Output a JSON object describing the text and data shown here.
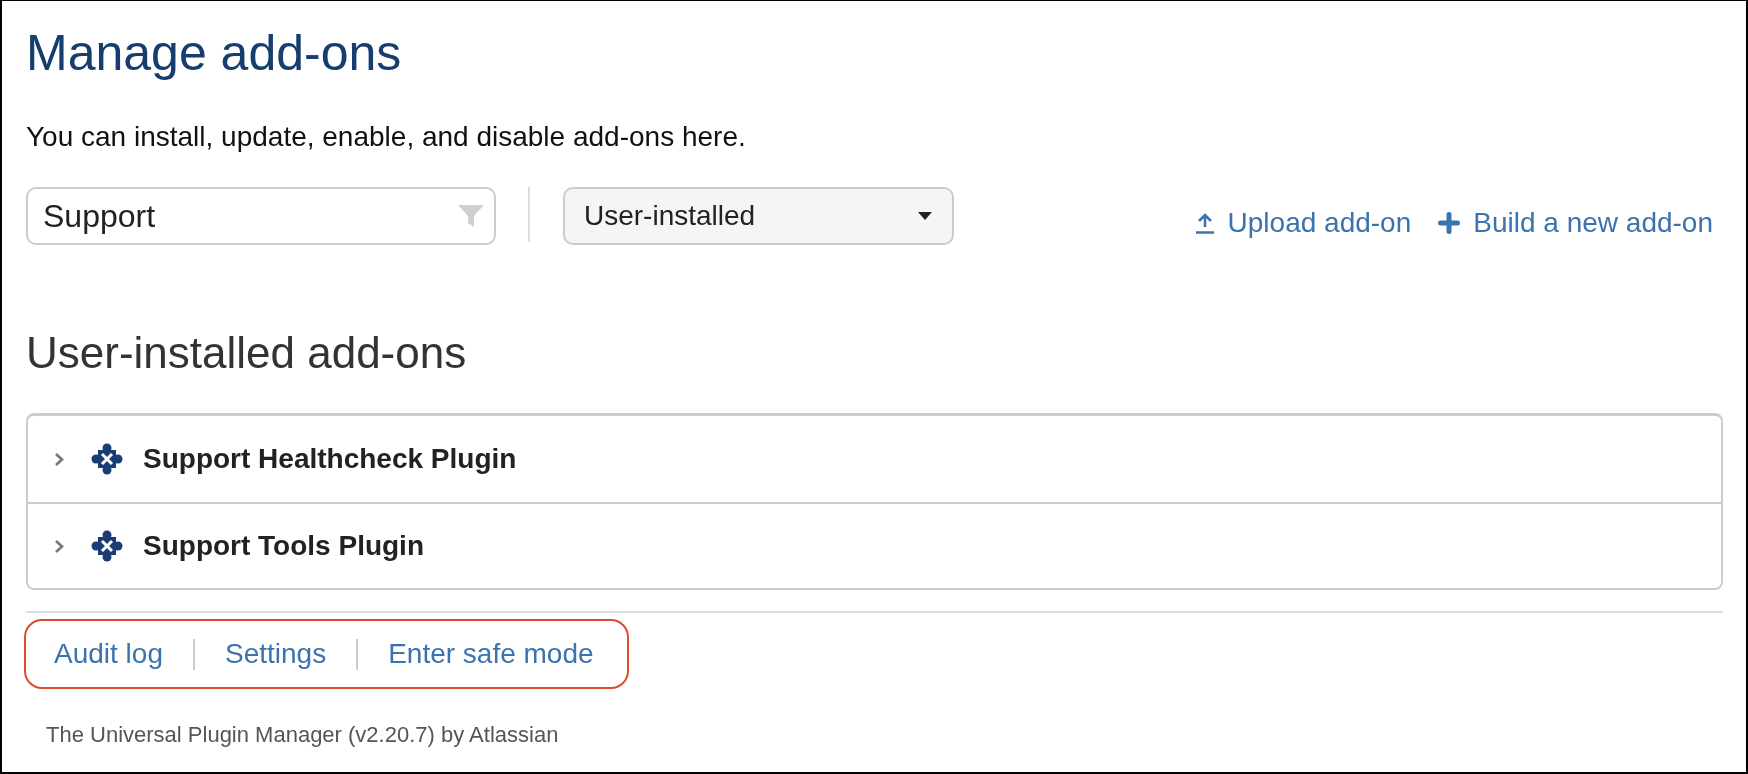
{
  "title": "Manage add-ons",
  "description": "You can install, update, enable, and disable add-ons here.",
  "filter": {
    "value": "Support"
  },
  "scope_select": {
    "value": "User-installed"
  },
  "actions": [
    {
      "kind": "upload",
      "label": "Upload add-on"
    },
    {
      "kind": "build",
      "label": "Build a new add-on"
    }
  ],
  "section": {
    "title": "User-installed add-ons",
    "addons": [
      {
        "name": "Support Healthcheck Plugin",
        "expanded": false
      },
      {
        "name": "Support Tools Plugin",
        "expanded": false
      }
    ]
  },
  "footer": {
    "highlighted": true,
    "links": [
      "Audit log",
      "Settings",
      "Enter safe mode"
    ]
  },
  "footer_note": "The Universal Plugin Manager (v2.20.7) by Atlassian"
}
